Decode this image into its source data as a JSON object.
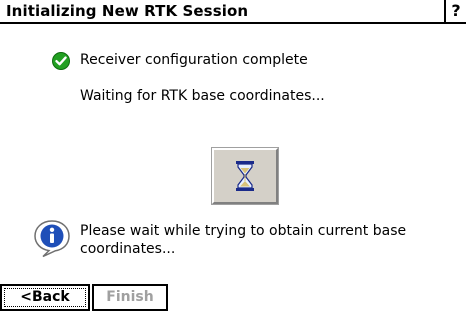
{
  "window": {
    "title": "Initializing New RTK Session",
    "help_label": "?"
  },
  "status": {
    "complete_text": "Receiver configuration complete",
    "waiting_text": "Waiting for RTK base coordinates..."
  },
  "info": {
    "message": "Please wait while trying to obtain current base coordinates..."
  },
  "buttons": {
    "back_label": "<Back",
    "finish_label": "Finish"
  },
  "colors": {
    "check_green": "#22a022",
    "info_blue": "#1f4fb8",
    "disabled_text": "#a0a0a0",
    "button_face": "#d4d0c8"
  },
  "icons": {
    "status": "check-circle-icon",
    "busy": "hourglass-icon",
    "info": "info-balloon-icon"
  }
}
